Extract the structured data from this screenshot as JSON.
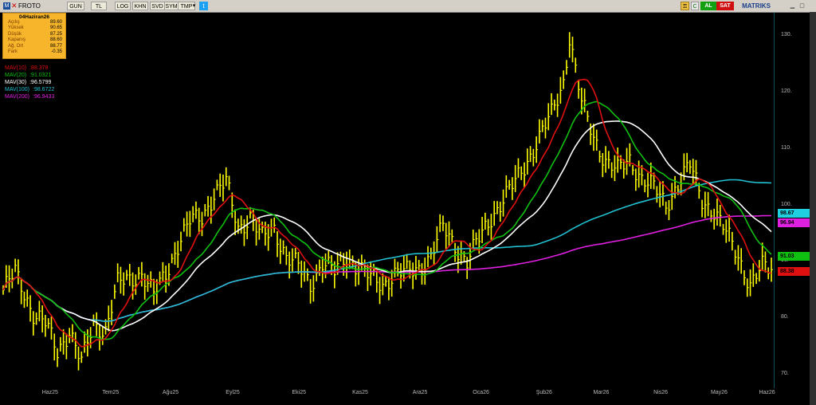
{
  "toolbar": {
    "symbol": "FROTO",
    "buttons": [
      "GUN",
      "TL",
      "LOG",
      "KHN",
      "SVD",
      "SYM",
      "TMP"
    ],
    "right": {
      "c_label": "C",
      "al_label": "AL",
      "sat_label": "SAT",
      "brand": "MATRIKS"
    }
  },
  "info": {
    "date": "04Haziran26",
    "rows": [
      {
        "label": "Açılış",
        "value": "89.60"
      },
      {
        "label": "Yüksek",
        "value": "90.65"
      },
      {
        "label": "Düşük",
        "value": "87.25"
      },
      {
        "label": "Kapanış",
        "value": "88.60"
      },
      {
        "label": "Ağ. Ort",
        "value": "88.77"
      },
      {
        "label": "Fark",
        "value": "-0.35"
      }
    ]
  },
  "legend": [
    {
      "name": "MAV(10)",
      "value": ":88.378",
      "color": "#e01010"
    },
    {
      "name": "MAV(20)",
      "value": ":91.0321",
      "color": "#10c010"
    },
    {
      "name": "MAV(30)",
      "value": ":96.5799",
      "color": "#ffffff"
    },
    {
      "name": "MAV(100)",
      "value": ":98.6722",
      "color": "#20c0d0"
    },
    {
      "name": "MAV(200)",
      "value": ":96.9433",
      "color": "#e020e0"
    }
  ],
  "tags": [
    {
      "text": "98.67",
      "value": 98.67,
      "bg": "#20d0e0",
      "fg": "#000000"
    },
    {
      "text": "96.94",
      "value": 96.94,
      "bg": "#e020e0",
      "fg": "#000000"
    },
    {
      "text": "91.03",
      "value": 91.03,
      "bg": "#10c010",
      "fg": "#000000"
    },
    {
      "text": "88.38",
      "value": 88.38,
      "bg": "#e01010",
      "fg": "#000000"
    }
  ],
  "chart_data": {
    "type": "bar",
    "price_style": "hlc-bars",
    "bar_color": "#ffff00",
    "y_ticks": [
      70,
      80,
      90,
      100,
      110,
      120,
      130
    ],
    "y_tick_labels": [
      "70.",
      "80.",
      "90.",
      "100.",
      "110.",
      "120.",
      "130."
    ],
    "ylim": [
      68,
      134
    ],
    "x_labels": [
      "Haz25",
      "Tem25",
      "Ağu25",
      "Eyl25",
      "Eki25",
      "Kas25",
      "Ara25",
      "Oca26",
      "Şub26",
      "Mar26",
      "Nis26",
      "May26",
      "Haz26"
    ],
    "x_label_index": [
      15,
      35,
      55,
      76,
      98,
      118,
      138,
      158,
      179,
      198,
      218,
      237,
      253
    ],
    "bar_count": 256,
    "close_anchors": [
      [
        0,
        85
      ],
      [
        4,
        88
      ],
      [
        10,
        81
      ],
      [
        14,
        79
      ],
      [
        18,
        74
      ],
      [
        22,
        78
      ],
      [
        26,
        72
      ],
      [
        30,
        79
      ],
      [
        34,
        78
      ],
      [
        38,
        86
      ],
      [
        42,
        87
      ],
      [
        46,
        88
      ],
      [
        50,
        84
      ],
      [
        54,
        88
      ],
      [
        58,
        93
      ],
      [
        62,
        97
      ],
      [
        66,
        98
      ],
      [
        70,
        102
      ],
      [
        74,
        104
      ],
      [
        78,
        96
      ],
      [
        82,
        98
      ],
      [
        86,
        94
      ],
      [
        90,
        96
      ],
      [
        94,
        91
      ],
      [
        98,
        89
      ],
      [
        102,
        86
      ],
      [
        106,
        90
      ],
      [
        110,
        88
      ],
      [
        114,
        91
      ],
      [
        118,
        89
      ],
      [
        122,
        87
      ],
      [
        126,
        86
      ],
      [
        130,
        88
      ],
      [
        134,
        88
      ],
      [
        138,
        89
      ],
      [
        142,
        91
      ],
      [
        146,
        96
      ],
      [
        150,
        93
      ],
      [
        154,
        90
      ],
      [
        158,
        94
      ],
      [
        162,
        98
      ],
      [
        166,
        101
      ],
      [
        170,
        104
      ],
      [
        174,
        108
      ],
      [
        178,
        112
      ],
      [
        182,
        116
      ],
      [
        186,
        122
      ],
      [
        188,
        130
      ],
      [
        192,
        118
      ],
      [
        196,
        112
      ],
      [
        200,
        108
      ],
      [
        204,
        106
      ],
      [
        208,
        108
      ],
      [
        212,
        105
      ],
      [
        216,
        103
      ],
      [
        220,
        100
      ],
      [
        224,
        104
      ],
      [
        228,
        107
      ],
      [
        232,
        101
      ],
      [
        236,
        99
      ],
      [
        240,
        95
      ],
      [
        244,
        91
      ],
      [
        248,
        86
      ],
      [
        252,
        89
      ],
      [
        255,
        88.6
      ]
    ],
    "series": [
      {
        "name": "MAV(10)",
        "period": 10,
        "color": "#e01010"
      },
      {
        "name": "MAV(20)",
        "period": 20,
        "color": "#10c010"
      },
      {
        "name": "MAV(30)",
        "period": 30,
        "color": "#ffffff"
      },
      {
        "name": "MAV(100)",
        "period": 100,
        "color": "#20c0d0"
      },
      {
        "name": "MAV(200)",
        "period": 200,
        "color": "#e020e0"
      }
    ],
    "grid": false
  }
}
